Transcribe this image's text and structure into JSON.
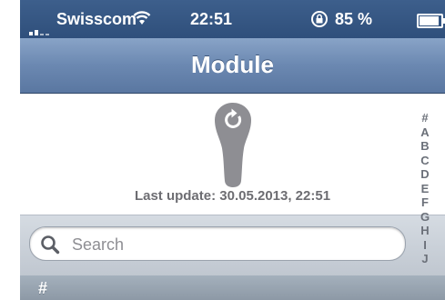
{
  "status_bar": {
    "carrier": "Swisscom",
    "time": "22:51",
    "battery": "85 %",
    "battery_level": 0.85
  },
  "navbar": {
    "title": "Module"
  },
  "refresh": {
    "last_update": "Last update: 30.05.2013, 22:51"
  },
  "search": {
    "placeholder": "Search"
  },
  "section": {
    "header": "#"
  },
  "index": [
    "#",
    "A",
    "B",
    "C",
    "D",
    "E",
    "F",
    "G",
    "H",
    "I",
    "J"
  ],
  "icons": {
    "refresh": "refresh-icon",
    "search": "search-icon",
    "wifi": "wifi-icon",
    "rotation_lock": "rotation-lock-icon",
    "battery": "battery-icon",
    "signal": "signal-icon"
  },
  "colors": {
    "status_bar": "#2f4f7b",
    "navbar": "#6b88b1",
    "index_text": "#6b7079",
    "refresh_shape": "#8e8e93"
  }
}
